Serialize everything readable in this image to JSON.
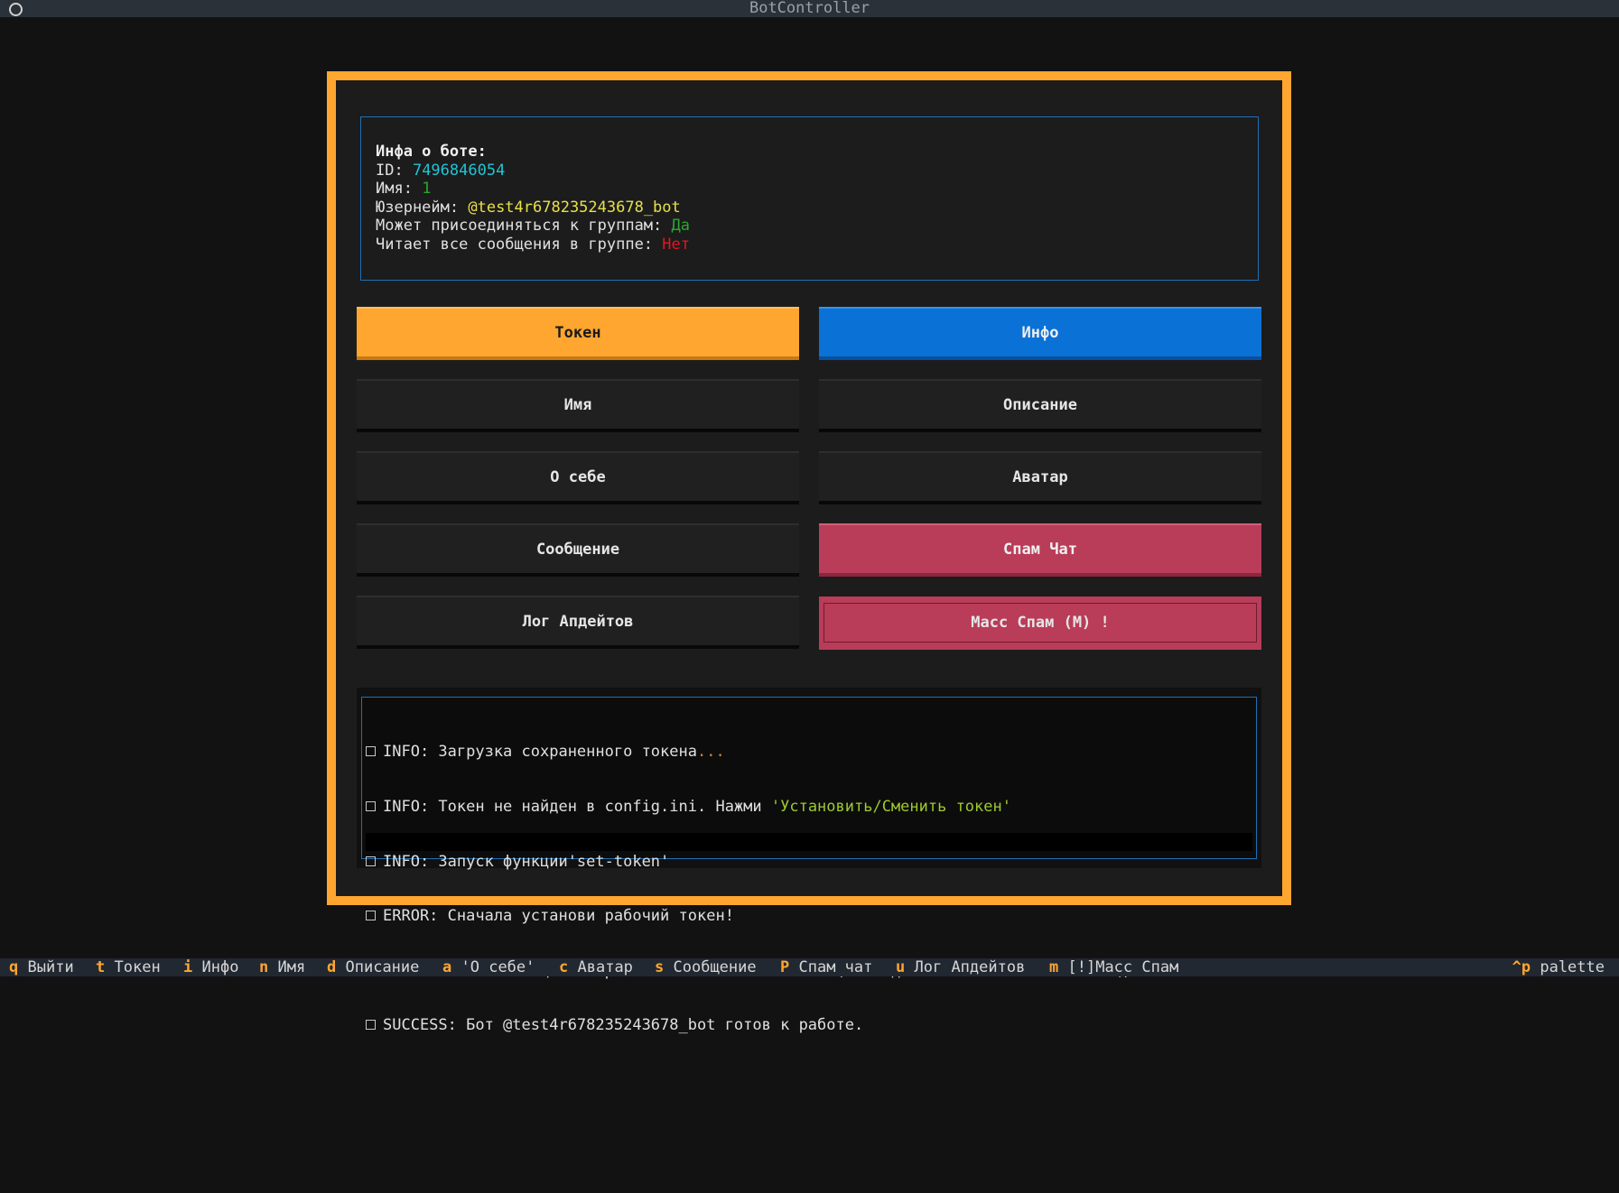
{
  "window": {
    "title": "BotController"
  },
  "info": {
    "header": "Инфа о боте:",
    "id_label": "ID: ",
    "id_value": "7496846054",
    "name_label": "Имя: ",
    "name_value": "1",
    "username_label": "Юзернейм: ",
    "username_value": "@test4r678235243678_bot",
    "can_join_label": "Может присоединяться к группам: ",
    "can_join_value": "Да",
    "reads_all_label": "Читает все сообщения в группе: ",
    "reads_all_value": "Нет"
  },
  "buttons": {
    "token": "Токен",
    "info": "Инфо",
    "name": "Имя",
    "description": "Описание",
    "about": "О себе",
    "avatar": "Аватар",
    "message": "Сообщение",
    "spam_chat": "Спам Чат",
    "update_log": "Лог Апдейтов",
    "mass_spam": "Масс Спам (M) !"
  },
  "log": {
    "l1_text": "INFO: Загрузка сохраненного токена",
    "l1_dots": "...",
    "l2_text": "INFO: Токен не найден в config.ini. Нажми ",
    "l2_quote": "'Установить/Сменить токен'",
    "l3_text": "INFO: Запуск функции'set-token'",
    "l4_text": "ERROR: Сначала установи рабочий токен!",
    "l5_a": "INFO: Пытаюсь инициализировать бота с токеном",
    "l5_dots": "...",
    "l5_b": " (последние ",
    "l5_num": "5",
    "l5_c": " символов: ",
    "l5_dots2": "...",
    "l5_d": "BWJoQ)",
    "l6_text": "SUCCESS: Бот @test4r678235243678_bot готов к работе."
  },
  "footer": {
    "items": [
      {
        "key": "q",
        "label": "Выйти"
      },
      {
        "key": "t",
        "label": "Токен"
      },
      {
        "key": "i",
        "label": "Инфо"
      },
      {
        "key": "n",
        "label": "Имя"
      },
      {
        "key": "d",
        "label": "Описание"
      },
      {
        "key": "a",
        "label": "'О себе'"
      },
      {
        "key": "c",
        "label": "Аватар"
      },
      {
        "key": "s",
        "label": "Сообщение"
      },
      {
        "key": "P",
        "label": "Спам чат"
      },
      {
        "key": "u",
        "label": "Лог Апдейтов"
      },
      {
        "key": "m",
        "label": "[!]Масс Спам"
      }
    ],
    "palette_key": "^p",
    "palette_label": "palette"
  },
  "colors": {
    "accent": "#ffa630",
    "primary": "#0a72d6",
    "danger": "#b93c58",
    "panel_border": "#1f6fb5"
  }
}
